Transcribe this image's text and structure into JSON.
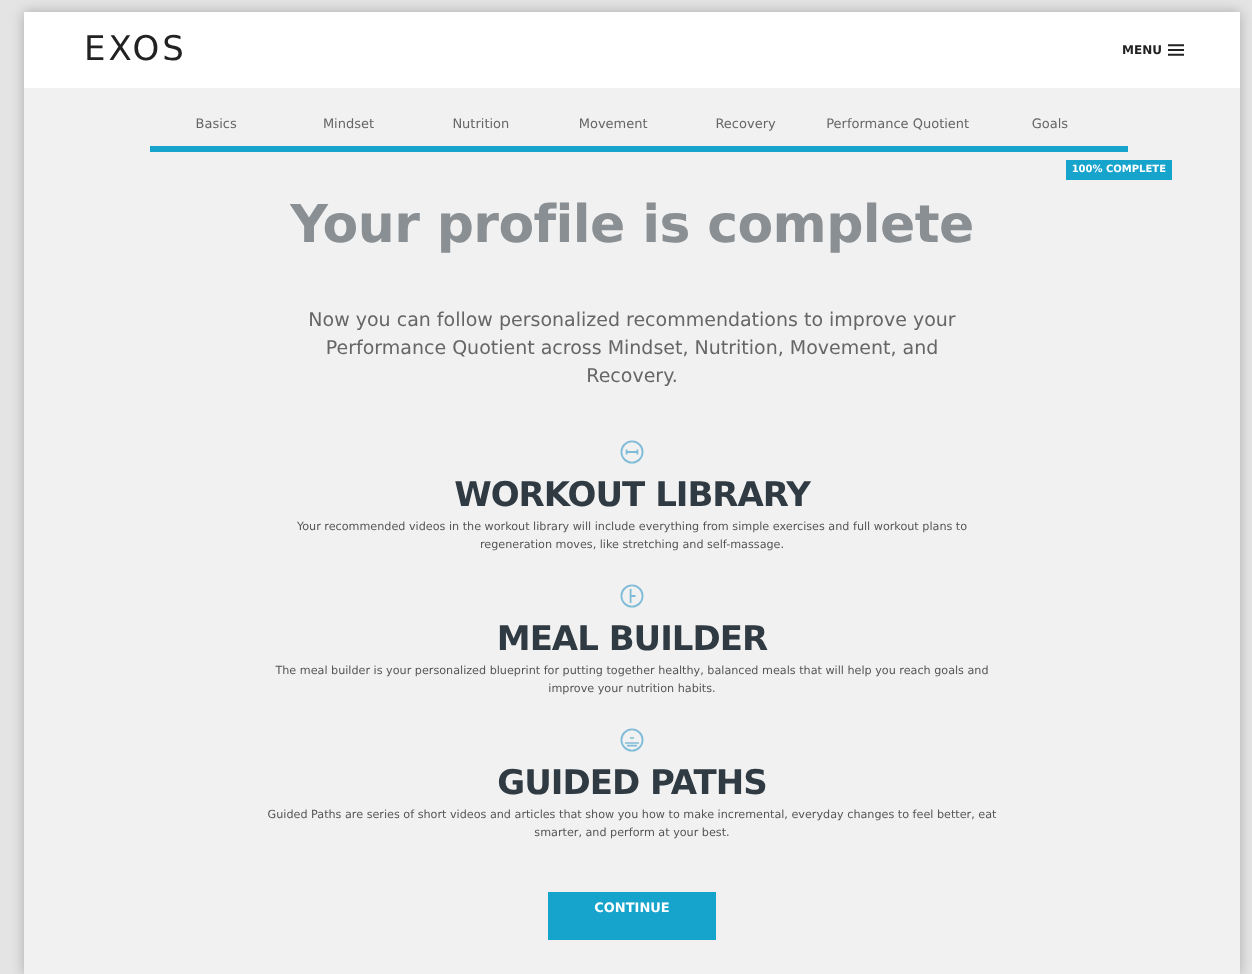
{
  "header": {
    "logo": "EXOS",
    "menu": "MENU"
  },
  "steps": [
    "Basics",
    "Mindset",
    "Nutrition",
    "Movement",
    "Recovery",
    "Performance Quotient",
    "Goals"
  ],
  "progress": {
    "level": 1.0,
    "badge": "100% COMPLETE"
  },
  "title": "Your profile is complete",
  "intro": "Now you can follow personalized recommendations to improve your Performance Quotient across Mindset, Nutrition, Movement, and Recovery.",
  "features": [
    {
      "kind": "workout",
      "heading": "WORKOUT LIBRARY",
      "text": "Your recommended videos in the workout library will include everything from simple exercises and full workout plans to regeneration moves, like stretching and self-massage."
    },
    {
      "kind": "meal",
      "heading": "MEAL BUILDER",
      "text": "The meal builder is your personalized blueprint for putting together healthy, balanced meals that will help you reach goals and improve your nutrition habits."
    },
    {
      "kind": "paths",
      "heading": "GUIDED PATHS",
      "text": "Guided Paths are series of short videos and articles that show you how to make incremental, everyday changes to feel better, eat smarter, and perform at your best."
    }
  ],
  "button": "CONTINUE"
}
